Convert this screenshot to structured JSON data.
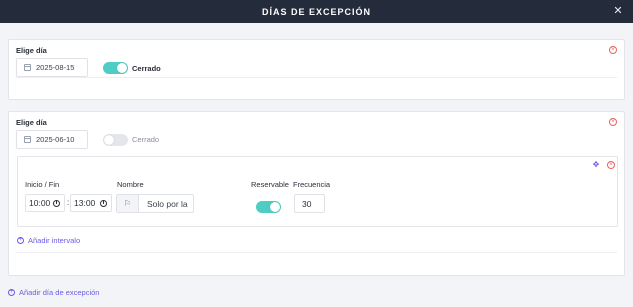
{
  "header": {
    "title": "DÍAS DE EXCEPCIÓN",
    "close_icon": "close-icon"
  },
  "days": [
    {
      "label": "Elige día",
      "date": "2025-08-15",
      "closed_label": "Cerrado",
      "closed": true
    },
    {
      "label": "Elige día",
      "date": "2025-06-10",
      "closed_label": "Cerrado",
      "closed": false,
      "interval": {
        "start_end_label": "Inicio / Fin",
        "start_time": "10:00",
        "end_time": "13:00",
        "separator": ":",
        "name_label": "Nombre",
        "name_value": "Solo por la",
        "reservable_label": "Reservable",
        "reservable": true,
        "frequency_label": "Frecuencia",
        "frequency_value": "30"
      },
      "add_interval_label": "Añadir intervalo"
    }
  ],
  "add_exception_label": "Añadir día de excepción",
  "colors": {
    "header_bg": "#242b3b",
    "toggle_on": "#4ecdc4",
    "accent": "#6b5ce7",
    "danger": "#e8625c"
  }
}
